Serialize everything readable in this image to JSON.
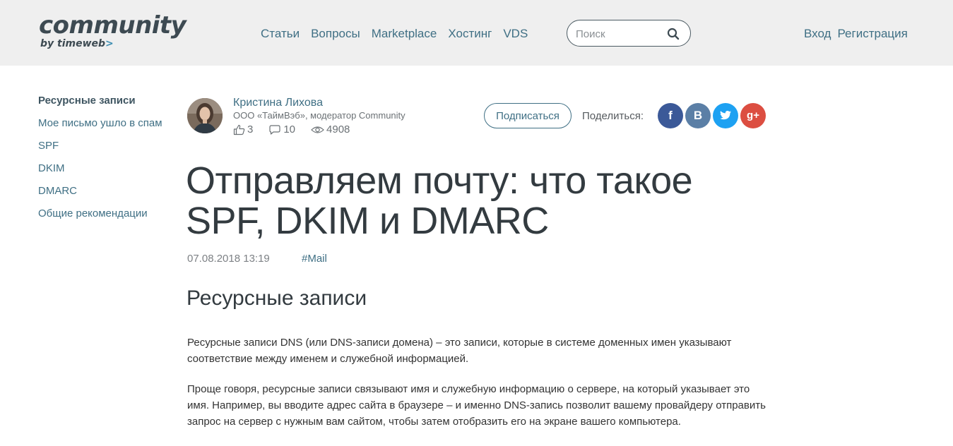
{
  "header": {
    "logo_main": "community",
    "logo_sub": "by timeweb",
    "logo_arrow": ">",
    "nav": [
      "Статьи",
      "Вопросы",
      "Marketplace",
      "Хостинг",
      "VDS"
    ],
    "search_placeholder": "Поиск",
    "login": "Вход",
    "register": "Регистрация"
  },
  "toc": {
    "items": [
      "Ресурсные записи",
      "Мое письмо ушло в спам",
      "SPF",
      "DKIM",
      "DMARC",
      "Общие рекомендации"
    ],
    "active_index": 0
  },
  "author": {
    "name": "Кристина Лихова",
    "role": "ООО «ТаймВэб», модератор Community",
    "likes": "3",
    "comments": "10",
    "views": "4908"
  },
  "actions": {
    "subscribe": "Подписаться",
    "share_label": "Поделиться:",
    "share_icons": [
      "facebook-icon",
      "vk-icon",
      "twitter-icon",
      "google-plus-icon"
    ],
    "fb": "f",
    "vk": "B",
    "gp": "g+"
  },
  "article": {
    "title": "Отправляем почту: что такое SPF, DKIM и DMARC",
    "date": "07.08.2018 13:19",
    "tag": "#Mail",
    "section_title": "Ресурсные записи",
    "paragraph_1": "Ресурсные записи DNS (или DNS-записи домена) – это записи, которые в системе доменных имен указывают соответствие между именем и служебной информацией.",
    "paragraph_2": "Проще говоря, ресурсные записи связывают имя и служебную информацию о сервере, на который указывает это имя. Например, вы вводите адрес сайта в браузере – и именно DNS-запись позволит вашему провайдеру отправить запрос на сервер с нужным вам сайтом, чтобы затем отобразить его на экране вашего компьютера."
  },
  "colors": {
    "header_bg": "#efefef",
    "link": "#3f6f84",
    "facebook": "#3b5998",
    "vk": "#5b7fa6",
    "twitter": "#1da1f2",
    "google_plus": "#dc4e41"
  }
}
